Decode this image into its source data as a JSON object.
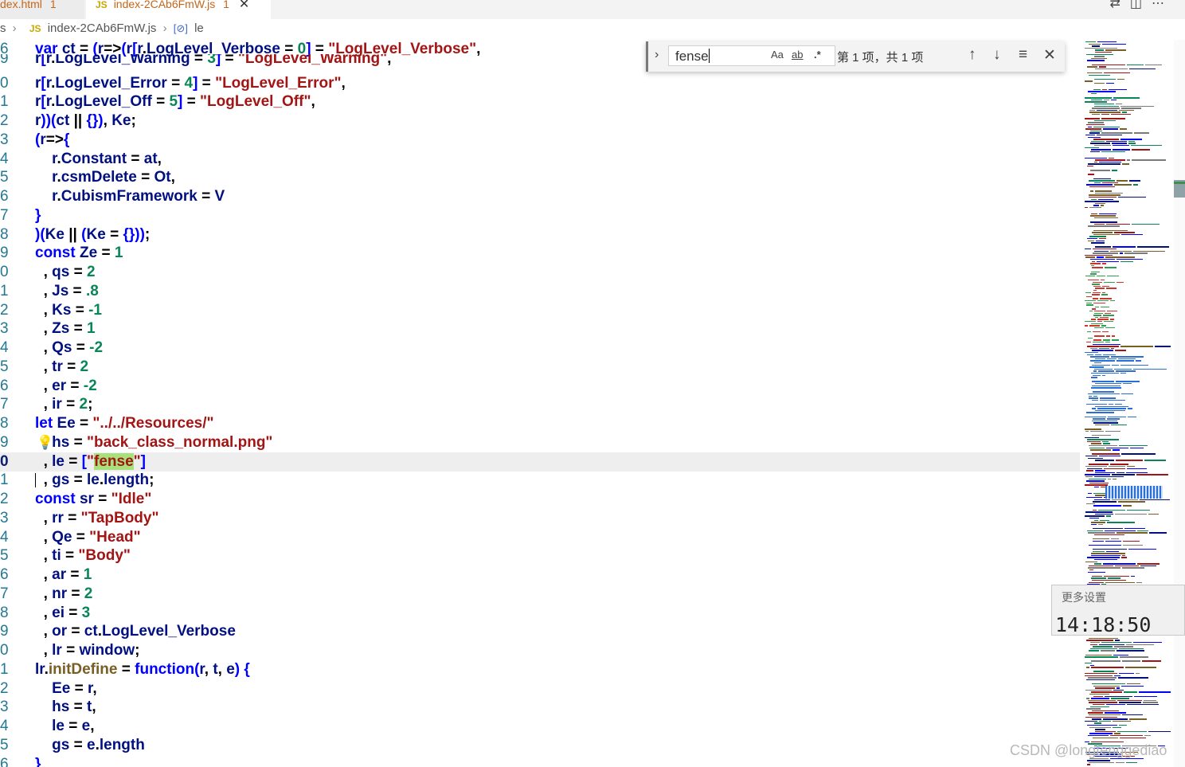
{
  "tabs": [
    {
      "label": "dex.html",
      "badge": "1",
      "active": false
    },
    {
      "label": "index-2CAb6FmW.js",
      "badge": "1",
      "active": true
    }
  ],
  "tab_icon_js": "JS",
  "breadcrumb": {
    "root": "s",
    "file_icon": "JS",
    "file": "index-2CAb6FmW.js",
    "symbol_icon": "[⊘]",
    "symbol": "le"
  },
  "find_widget": {
    "query": "fense",
    "match_case": "Aa",
    "whole_word": "ab",
    "regex": ".*",
    "result": "第 1 项，共 1 项"
  },
  "editor": {
    "line_numbers": [
      "6",
      "9",
      "0",
      "1",
      "2",
      "3",
      "4",
      "5",
      "6",
      "7",
      "8",
      "9",
      "0",
      "1",
      "2",
      "3",
      "4",
      "5",
      "6",
      "7",
      "8",
      "9",
      "0",
      "1",
      "2",
      "3",
      "4",
      "5",
      "6",
      "7",
      "8",
      "9",
      "0",
      "1",
      "2",
      "3",
      "4",
      "5",
      "6"
    ]
  },
  "overlay": {
    "more_settings": "更多设置",
    "time": "14:18:50"
  },
  "watermark": "CSDN @longtenggediao",
  "colors": {
    "keyword": "#0000ff",
    "string": "#a31515",
    "number": "#098658",
    "variable": "#001080",
    "function": "#795e26",
    "match_highlight": "#a8e07c"
  }
}
